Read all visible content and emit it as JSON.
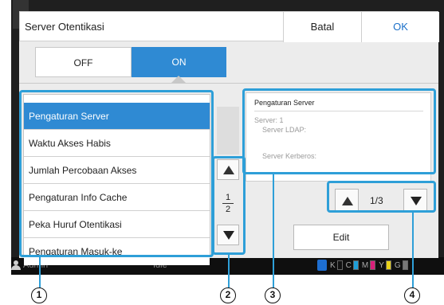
{
  "window": {
    "title": "Server Otentikasi",
    "cancel_label": "Batal",
    "ok_label": "OK"
  },
  "toggle": {
    "off_label": "OFF",
    "on_label": "ON",
    "selected": "ON"
  },
  "settings_list": {
    "items": [
      {
        "label": "Pengaturan Server",
        "selected": true
      },
      {
        "label": "Waktu Akses Habis",
        "selected": false
      },
      {
        "label": "Jumlah Percobaan Akses",
        "selected": false
      },
      {
        "label": "Pengaturan Info Cache",
        "selected": false
      },
      {
        "label": "Peka Huruf Otentikasi",
        "selected": false
      },
      {
        "label": "Pengaturan Masuk-ke",
        "selected": false
      }
    ],
    "page_current": "1",
    "page_total": "2"
  },
  "info_panel": {
    "title": "Pengaturan Server",
    "server_line": "Server: 1",
    "ldap_label": "Server LDAP:",
    "kerberos_label": "Server Kerberos:"
  },
  "info_pager": {
    "page_text": "1/3"
  },
  "edit_label": "Edit",
  "status_bar": {
    "user": "Admin",
    "state": "Idle",
    "inks": [
      "K",
      "C",
      "M",
      "Y",
      "G"
    ]
  },
  "callouts": [
    "1",
    "2",
    "3",
    "4"
  ],
  "colors": {
    "accent": "#2f8ad3",
    "highlight": "#2e9fd8",
    "ok_text": "#1a6fc8"
  }
}
